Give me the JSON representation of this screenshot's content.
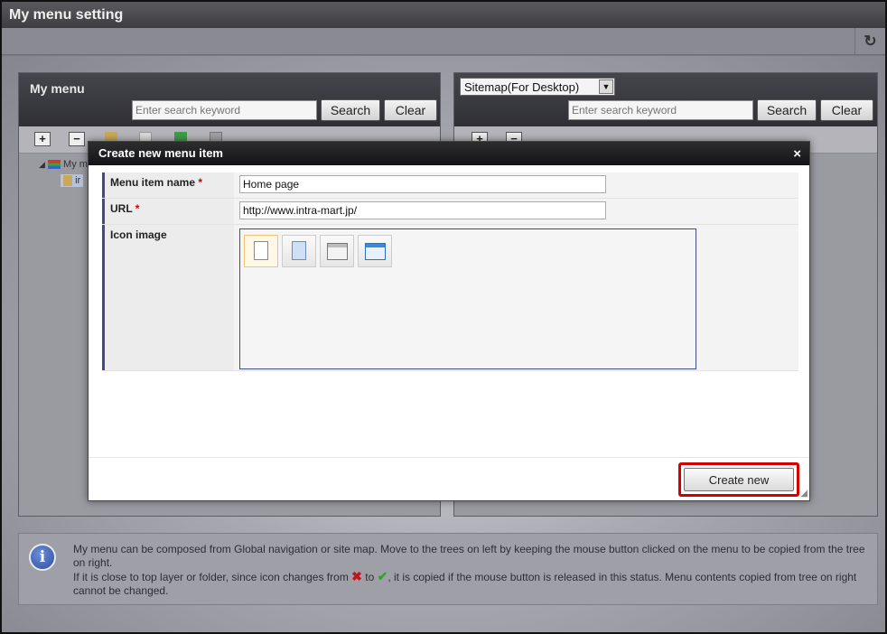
{
  "window": {
    "title": "My menu setting",
    "refresh_icon": "↻"
  },
  "left_panel": {
    "title": "My menu",
    "search_placeholder": "Enter search keyword",
    "search_label": "Search",
    "clear_label": "Clear",
    "tree": {
      "root_label": "My m",
      "child_label": "ir"
    }
  },
  "right_panel": {
    "source_select": "Sitemap(For Desktop)",
    "search_placeholder": "Enter search keyword",
    "search_label": "Search",
    "clear_label": "Clear"
  },
  "dialog": {
    "title": "Create new menu item",
    "close_icon": "×",
    "fields": {
      "name_label": "Menu item name",
      "name_value": "Home page",
      "url_label": "URL",
      "url_value": "http://www.intra-mart.jp/",
      "icon_label": "Icon image",
      "required_mark": "*"
    },
    "icons": [
      "document-icon",
      "blue-document-icon",
      "window-icon",
      "blue-window-icon"
    ],
    "create_label": "Create new"
  },
  "info": {
    "line1": "My menu can be composed from Global navigation or site map. Move to the trees on left by keeping the mouse button clicked on the menu to be copied from the tree on right.",
    "line2_a": "If it is close to top layer or folder, since icon changes from",
    "line2_b": "to",
    "line2_c": ", it is copied if the mouse button is released in this status. Menu contents copied from tree on right cannot be changed."
  },
  "colors": {
    "accent_red": "#d40000",
    "title_bar": "#3e3e42",
    "field_accent": "#3d4c86"
  }
}
